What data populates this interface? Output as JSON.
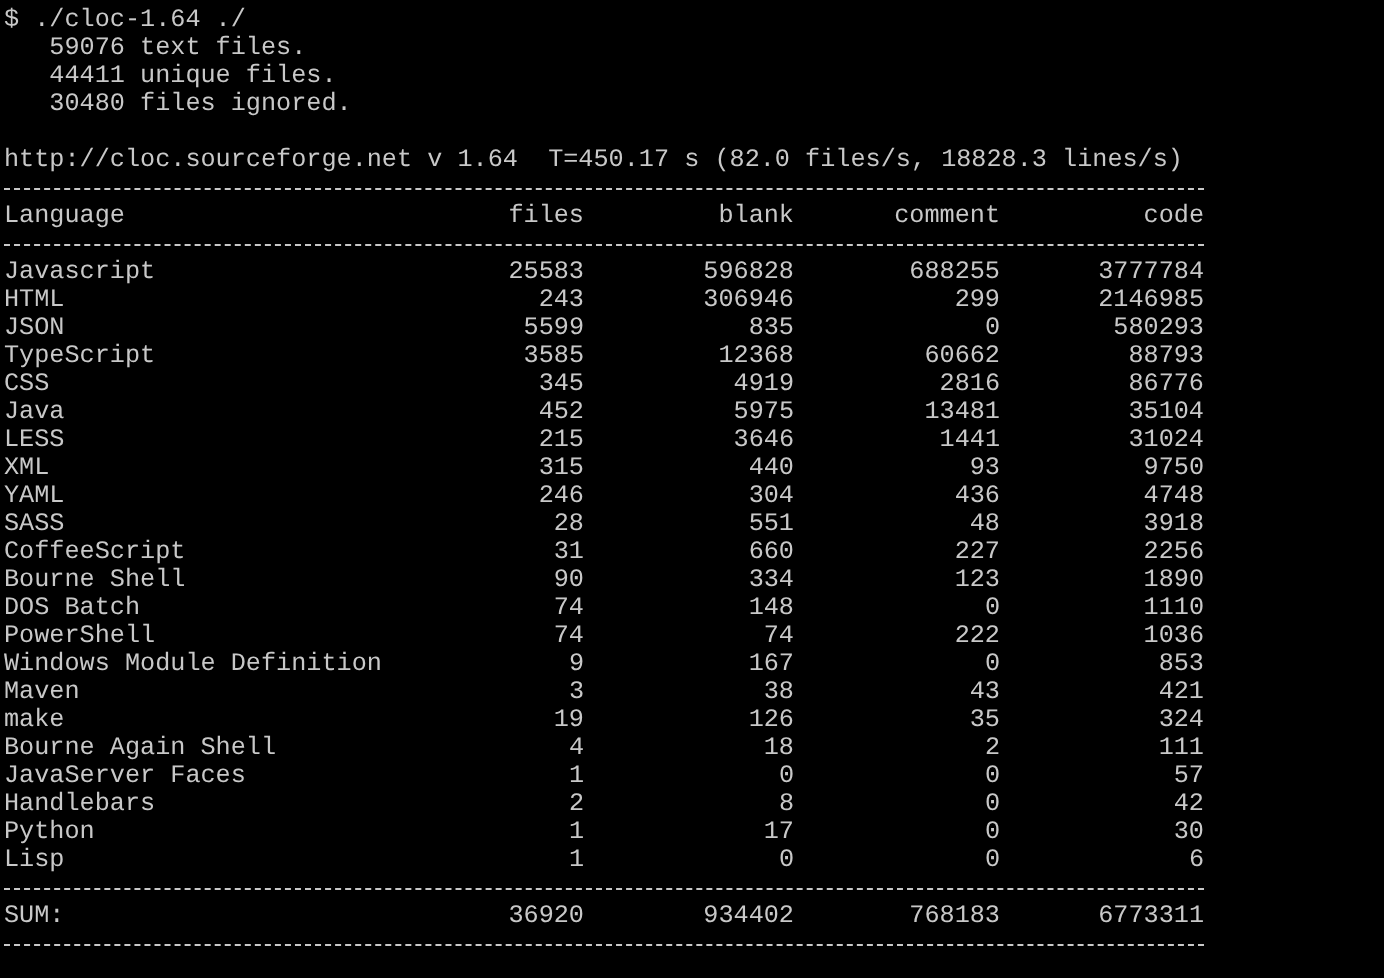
{
  "terminal": {
    "command": "$ ./cloc-1.64 ./",
    "summary_lines": [
      "   59076 text files.",
      "   44411 unique files.",
      "   30480 files ignored."
    ],
    "timing": "http://cloc.sourceforge.net v 1.64  T=450.17 s (82.0 files/s, 18828.3 lines/s)",
    "table": {
      "columns": [
        "Language",
        "files",
        "blank",
        "comment",
        "code"
      ],
      "rows": [
        [
          "Javascript",
          "25583",
          "596828",
          "688255",
          "3777784"
        ],
        [
          "HTML",
          "243",
          "306946",
          "299",
          "2146985"
        ],
        [
          "JSON",
          "5599",
          "835",
          "0",
          "580293"
        ],
        [
          "TypeScript",
          "3585",
          "12368",
          "60662",
          "88793"
        ],
        [
          "CSS",
          "345",
          "4919",
          "2816",
          "86776"
        ],
        [
          "Java",
          "452",
          "5975",
          "13481",
          "35104"
        ],
        [
          "LESS",
          "215",
          "3646",
          "1441",
          "31024"
        ],
        [
          "XML",
          "315",
          "440",
          "93",
          "9750"
        ],
        [
          "YAML",
          "246",
          "304",
          "436",
          "4748"
        ],
        [
          "SASS",
          "28",
          "551",
          "48",
          "3918"
        ],
        [
          "CoffeeScript",
          "31",
          "660",
          "227",
          "2256"
        ],
        [
          "Bourne Shell",
          "90",
          "334",
          "123",
          "1890"
        ],
        [
          "DOS Batch",
          "74",
          "148",
          "0",
          "1110"
        ],
        [
          "PowerShell",
          "74",
          "74",
          "222",
          "1036"
        ],
        [
          "Windows Module Definition",
          "9",
          "167",
          "0",
          "853"
        ],
        [
          "Maven",
          "3",
          "38",
          "43",
          "421"
        ],
        [
          "make",
          "19",
          "126",
          "35",
          "324"
        ],
        [
          "Bourne Again Shell",
          "4",
          "18",
          "2",
          "111"
        ],
        [
          "JavaServer Faces",
          "1",
          "0",
          "0",
          "57"
        ],
        [
          "Handlebars",
          "2",
          "8",
          "0",
          "42"
        ],
        [
          "Python",
          "1",
          "17",
          "0",
          "30"
        ],
        [
          "Lisp",
          "1",
          "0",
          "0",
          "6"
        ]
      ],
      "sum": [
        "SUM:",
        "36920",
        "934402",
        "768183",
        "6773311"
      ]
    }
  }
}
